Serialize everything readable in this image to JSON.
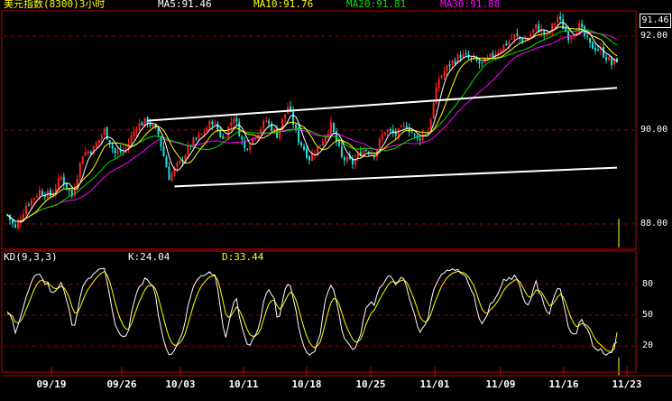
{
  "header": {
    "title": "美元指数(8300)3小时",
    "ma5": "MA5:91.46",
    "ma10": "MA10:91.76",
    "ma20": "MA20:91.81",
    "ma30": "MA30:91.88"
  },
  "kd_header": {
    "label": "KD(9,3,3)",
    "k": "K:24.04",
    "d": "D:33.44"
  },
  "last_price": "91.46",
  "colors": {
    "background": "#000000",
    "up": "#ff2020",
    "down": "#20e0e0",
    "ma5": "#ffffff",
    "ma10": "#ffff00",
    "ma20": "#00e000",
    "ma30": "#ff00ff",
    "grid": "#a00000",
    "frame": "#c00000",
    "trendline": "#ffffff",
    "title": "#ffff00",
    "kd_k": "#ffffff",
    "kd_d": "#ffff00"
  },
  "chart_data": [
    {
      "type": "candlestick",
      "title": "美元指数(8300)3小时",
      "x_labels": [
        "09/19",
        "09/26",
        "10/03",
        "10/11",
        "10/18",
        "10/25",
        "11/01",
        "11/09",
        "11/16",
        "11/23"
      ],
      "y_ticks": [
        "92.00",
        "90.00",
        "88.00"
      ],
      "ylim": [
        87.5,
        92.5
      ],
      "grid": true,
      "anchors": [
        [
          0,
          88.2
        ],
        [
          3,
          87.9
        ],
        [
          7,
          88.4
        ],
        [
          12,
          88.7
        ],
        [
          16,
          88.6
        ],
        [
          20,
          89.0
        ],
        [
          24,
          88.6
        ],
        [
          28,
          89.5
        ],
        [
          32,
          89.6
        ],
        [
          36,
          90.0
        ],
        [
          40,
          89.5
        ],
        [
          44,
          89.6
        ],
        [
          48,
          90.1
        ],
        [
          52,
          90.2
        ],
        [
          56,
          89.9
        ],
        [
          60,
          89.0
        ],
        [
          64,
          89.3
        ],
        [
          68,
          89.7
        ],
        [
          72,
          89.9
        ],
        [
          76,
          90.2
        ],
        [
          80,
          89.8
        ],
        [
          84,
          90.3
        ],
        [
          88,
          89.6
        ],
        [
          92,
          89.9
        ],
        [
          96,
          90.2
        ],
        [
          100,
          89.9
        ],
        [
          104,
          90.5
        ],
        [
          108,
          89.8
        ],
        [
          112,
          89.4
        ],
        [
          116,
          89.7
        ],
        [
          120,
          90.1
        ],
        [
          124,
          89.4
        ],
        [
          128,
          89.3
        ],
        [
          132,
          89.6
        ],
        [
          136,
          89.5
        ],
        [
          140,
          90.0
        ],
        [
          144,
          89.9
        ],
        [
          148,
          90.1
        ],
        [
          152,
          89.8
        ],
        [
          156,
          90.0
        ],
        [
          160,
          91.1
        ],
        [
          164,
          91.4
        ],
        [
          168,
          91.6
        ],
        [
          172,
          91.5
        ],
        [
          176,
          91.4
        ],
        [
          180,
          91.6
        ],
        [
          184,
          91.8
        ],
        [
          188,
          92.0
        ],
        [
          192,
          91.9
        ],
        [
          196,
          92.2
        ],
        [
          200,
          92.0
        ],
        [
          204,
          92.4
        ],
        [
          208,
          92.0
        ],
        [
          212,
          92.2
        ],
        [
          216,
          91.8
        ],
        [
          220,
          91.7
        ],
        [
          224,
          91.4
        ],
        [
          226,
          91.5
        ]
      ],
      "ma": {
        "ma5": 5,
        "ma10": 10,
        "ma20": 20,
        "ma30": 30
      },
      "trendlines": [
        {
          "from": [
            52,
            90.2
          ],
          "to": [
            226,
            90.9
          ]
        },
        {
          "from": [
            62,
            88.8
          ],
          "to": [
            226,
            89.2
          ]
        }
      ]
    },
    {
      "type": "line",
      "title": "KD(9,3,3)",
      "series": [
        {
          "name": "K"
        },
        {
          "name": "D"
        }
      ],
      "y_ticks": [
        "80",
        "50",
        "20"
      ],
      "ylim": [
        0,
        100
      ],
      "grid": true,
      "last": {
        "K": 24.04,
        "D": 33.44
      }
    }
  ]
}
